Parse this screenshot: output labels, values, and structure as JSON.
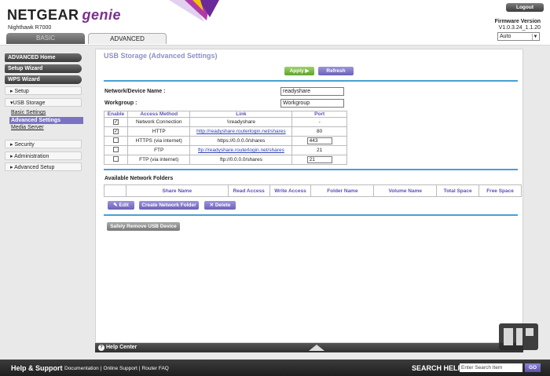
{
  "header": {
    "brand": "NETGEAR",
    "brand_suffix": "genie",
    "model": "Nighthawk R7000",
    "logout": "Logout",
    "firmware_label": "Firmware Version",
    "firmware_value": "V1.0.3.24_1.1.20",
    "language": "Auto",
    "tabs": {
      "basic": "BASIC",
      "advanced": "ADVANCED"
    }
  },
  "sidebar": {
    "advanced_home": "ADVANCED Home",
    "setup_wizard": "Setup Wizard",
    "wps_wizard": "WPS Wizard",
    "setup": "▸ Setup",
    "usb_storage": "▾USB Storage",
    "basic_settings": "Basic Settings",
    "advanced_settings": "Advanced Settings",
    "media_server": "Media Server",
    "security": "▸ Security",
    "administration": "▸ Administration",
    "advanced_setup": "▸ Advanced Setup"
  },
  "main": {
    "title": "USB Storage (Advanced Settings)",
    "apply": "Apply ▶",
    "refresh": "Refresh",
    "device_name_label": "Network/Device Name :",
    "device_name_value": "readyshare",
    "workgroup_label": "Workgroup :",
    "workgroup_value": "Workgroup",
    "access_table": {
      "headers": {
        "enable": "Enable",
        "method": "Access Method",
        "link": "Link",
        "port": "Port"
      },
      "rows": [
        {
          "checked": "✓",
          "method": "Network Connection",
          "link": "\\\\readyshare",
          "port": "-"
        },
        {
          "checked": "✓",
          "method": "HTTP",
          "link": "http://readyshare.routerlogin.net/shares",
          "port": "80"
        },
        {
          "checked": "",
          "method": "HTTPS (via internet)",
          "link": "https://0.0.0.0/shares",
          "port": "443"
        },
        {
          "checked": "",
          "method": "FTP",
          "link": "ftp://readyshare.routerlogin.net/shares",
          "port": "21"
        },
        {
          "checked": "",
          "method": "FTP (via internet)",
          "link": "ftp://0.0.0.0/shares",
          "port": "21"
        }
      ]
    },
    "folders_label": "Available Network Folders",
    "folders_table": {
      "share_name": "Share Name",
      "read_access": "Read Access",
      "write_access": "Write Access",
      "folder_name": "Folder Name",
      "volume_name": "Volume Name",
      "total_space": "Total Space",
      "free_space": "Free Space"
    },
    "edit": "✎ Edit",
    "create": "Create Network Folder",
    "delete": "✕ Delete",
    "safe_remove": "Safely Remove USB Device"
  },
  "help_center": "Help Center",
  "footer": {
    "help_support": "Help & Support",
    "documentation": "Documentation",
    "online_support": "Online Support",
    "router_faq": "Router FAQ",
    "search_help": "SEARCH HELP",
    "search_placeholder": "Enter Search Item",
    "go": "GO"
  },
  "colors": {
    "accent_purple": "#7a73c5",
    "apply_green": "#5ea32b",
    "divider_blue": "#4a9fd4"
  }
}
